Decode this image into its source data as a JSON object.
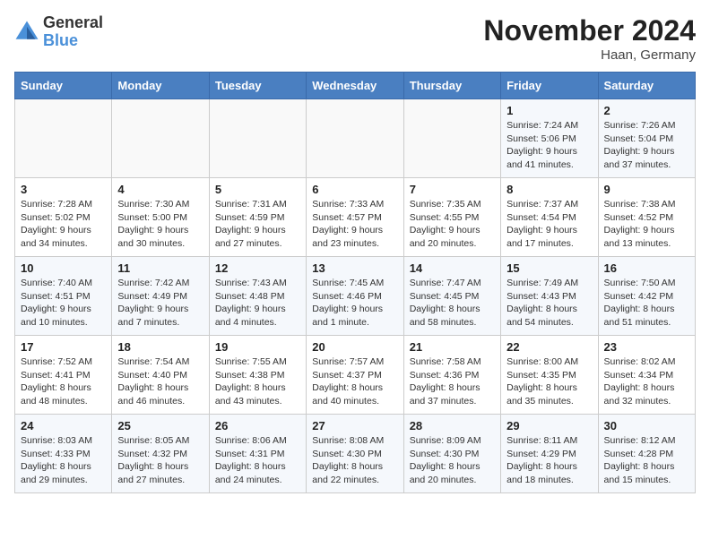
{
  "header": {
    "logo_text_general": "General",
    "logo_text_blue": "Blue",
    "month_title": "November 2024",
    "location": "Haan, Germany"
  },
  "calendar": {
    "days_of_week": [
      "Sunday",
      "Monday",
      "Tuesday",
      "Wednesday",
      "Thursday",
      "Friday",
      "Saturday"
    ],
    "weeks": [
      [
        {
          "day": "",
          "sunrise": "",
          "sunset": "",
          "daylight": ""
        },
        {
          "day": "",
          "sunrise": "",
          "sunset": "",
          "daylight": ""
        },
        {
          "day": "",
          "sunrise": "",
          "sunset": "",
          "daylight": ""
        },
        {
          "day": "",
          "sunrise": "",
          "sunset": "",
          "daylight": ""
        },
        {
          "day": "",
          "sunrise": "",
          "sunset": "",
          "daylight": ""
        },
        {
          "day": "1",
          "sunrise": "Sunrise: 7:24 AM",
          "sunset": "Sunset: 5:06 PM",
          "daylight": "Daylight: 9 hours and 41 minutes."
        },
        {
          "day": "2",
          "sunrise": "Sunrise: 7:26 AM",
          "sunset": "Sunset: 5:04 PM",
          "daylight": "Daylight: 9 hours and 37 minutes."
        }
      ],
      [
        {
          "day": "3",
          "sunrise": "Sunrise: 7:28 AM",
          "sunset": "Sunset: 5:02 PM",
          "daylight": "Daylight: 9 hours and 34 minutes."
        },
        {
          "day": "4",
          "sunrise": "Sunrise: 7:30 AM",
          "sunset": "Sunset: 5:00 PM",
          "daylight": "Daylight: 9 hours and 30 minutes."
        },
        {
          "day": "5",
          "sunrise": "Sunrise: 7:31 AM",
          "sunset": "Sunset: 4:59 PM",
          "daylight": "Daylight: 9 hours and 27 minutes."
        },
        {
          "day": "6",
          "sunrise": "Sunrise: 7:33 AM",
          "sunset": "Sunset: 4:57 PM",
          "daylight": "Daylight: 9 hours and 23 minutes."
        },
        {
          "day": "7",
          "sunrise": "Sunrise: 7:35 AM",
          "sunset": "Sunset: 4:55 PM",
          "daylight": "Daylight: 9 hours and 20 minutes."
        },
        {
          "day": "8",
          "sunrise": "Sunrise: 7:37 AM",
          "sunset": "Sunset: 4:54 PM",
          "daylight": "Daylight: 9 hours and 17 minutes."
        },
        {
          "day": "9",
          "sunrise": "Sunrise: 7:38 AM",
          "sunset": "Sunset: 4:52 PM",
          "daylight": "Daylight: 9 hours and 13 minutes."
        }
      ],
      [
        {
          "day": "10",
          "sunrise": "Sunrise: 7:40 AM",
          "sunset": "Sunset: 4:51 PM",
          "daylight": "Daylight: 9 hours and 10 minutes."
        },
        {
          "day": "11",
          "sunrise": "Sunrise: 7:42 AM",
          "sunset": "Sunset: 4:49 PM",
          "daylight": "Daylight: 9 hours and 7 minutes."
        },
        {
          "day": "12",
          "sunrise": "Sunrise: 7:43 AM",
          "sunset": "Sunset: 4:48 PM",
          "daylight": "Daylight: 9 hours and 4 minutes."
        },
        {
          "day": "13",
          "sunrise": "Sunrise: 7:45 AM",
          "sunset": "Sunset: 4:46 PM",
          "daylight": "Daylight: 9 hours and 1 minute."
        },
        {
          "day": "14",
          "sunrise": "Sunrise: 7:47 AM",
          "sunset": "Sunset: 4:45 PM",
          "daylight": "Daylight: 8 hours and 58 minutes."
        },
        {
          "day": "15",
          "sunrise": "Sunrise: 7:49 AM",
          "sunset": "Sunset: 4:43 PM",
          "daylight": "Daylight: 8 hours and 54 minutes."
        },
        {
          "day": "16",
          "sunrise": "Sunrise: 7:50 AM",
          "sunset": "Sunset: 4:42 PM",
          "daylight": "Daylight: 8 hours and 51 minutes."
        }
      ],
      [
        {
          "day": "17",
          "sunrise": "Sunrise: 7:52 AM",
          "sunset": "Sunset: 4:41 PM",
          "daylight": "Daylight: 8 hours and 48 minutes."
        },
        {
          "day": "18",
          "sunrise": "Sunrise: 7:54 AM",
          "sunset": "Sunset: 4:40 PM",
          "daylight": "Daylight: 8 hours and 46 minutes."
        },
        {
          "day": "19",
          "sunrise": "Sunrise: 7:55 AM",
          "sunset": "Sunset: 4:38 PM",
          "daylight": "Daylight: 8 hours and 43 minutes."
        },
        {
          "day": "20",
          "sunrise": "Sunrise: 7:57 AM",
          "sunset": "Sunset: 4:37 PM",
          "daylight": "Daylight: 8 hours and 40 minutes."
        },
        {
          "day": "21",
          "sunrise": "Sunrise: 7:58 AM",
          "sunset": "Sunset: 4:36 PM",
          "daylight": "Daylight: 8 hours and 37 minutes."
        },
        {
          "day": "22",
          "sunrise": "Sunrise: 8:00 AM",
          "sunset": "Sunset: 4:35 PM",
          "daylight": "Daylight: 8 hours and 35 minutes."
        },
        {
          "day": "23",
          "sunrise": "Sunrise: 8:02 AM",
          "sunset": "Sunset: 4:34 PM",
          "daylight": "Daylight: 8 hours and 32 minutes."
        }
      ],
      [
        {
          "day": "24",
          "sunrise": "Sunrise: 8:03 AM",
          "sunset": "Sunset: 4:33 PM",
          "daylight": "Daylight: 8 hours and 29 minutes."
        },
        {
          "day": "25",
          "sunrise": "Sunrise: 8:05 AM",
          "sunset": "Sunset: 4:32 PM",
          "daylight": "Daylight: 8 hours and 27 minutes."
        },
        {
          "day": "26",
          "sunrise": "Sunrise: 8:06 AM",
          "sunset": "Sunset: 4:31 PM",
          "daylight": "Daylight: 8 hours and 24 minutes."
        },
        {
          "day": "27",
          "sunrise": "Sunrise: 8:08 AM",
          "sunset": "Sunset: 4:30 PM",
          "daylight": "Daylight: 8 hours and 22 minutes."
        },
        {
          "day": "28",
          "sunrise": "Sunrise: 8:09 AM",
          "sunset": "Sunset: 4:30 PM",
          "daylight": "Daylight: 8 hours and 20 minutes."
        },
        {
          "day": "29",
          "sunrise": "Sunrise: 8:11 AM",
          "sunset": "Sunset: 4:29 PM",
          "daylight": "Daylight: 8 hours and 18 minutes."
        },
        {
          "day": "30",
          "sunrise": "Sunrise: 8:12 AM",
          "sunset": "Sunset: 4:28 PM",
          "daylight": "Daylight: 8 hours and 15 minutes."
        }
      ]
    ]
  }
}
